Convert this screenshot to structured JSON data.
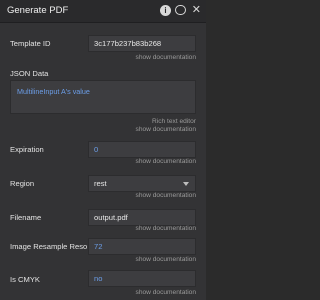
{
  "window": {
    "title": "Generate PDF",
    "icons": [
      "info-icon",
      "comment-icon",
      "close-icon"
    ]
  },
  "fields": {
    "template_id": {
      "label": "Template ID",
      "value": "3c177b237b83b268",
      "help": "show documentation"
    },
    "json_data": {
      "label": "JSON Data",
      "value": "MultilineInput A's value",
      "help1": "Rich text editor",
      "help2": "show documentation"
    },
    "expiration": {
      "label": "Expiration",
      "value": "0",
      "help": "show documentation"
    },
    "region": {
      "label": "Region",
      "value": "rest",
      "help": "show documentation"
    },
    "filename": {
      "label": "Filename",
      "value": "output.pdf",
      "help": "show documentation"
    },
    "image_resample": {
      "label": "Image Resample Reso",
      "value": "72",
      "help": "show documentation"
    },
    "is_cmyk": {
      "label": "Is CMYK",
      "value": "no",
      "help": "show documentation"
    }
  },
  "colors": {
    "dynamic_value": "#6c9ee8",
    "panel_bg": "#333335"
  }
}
